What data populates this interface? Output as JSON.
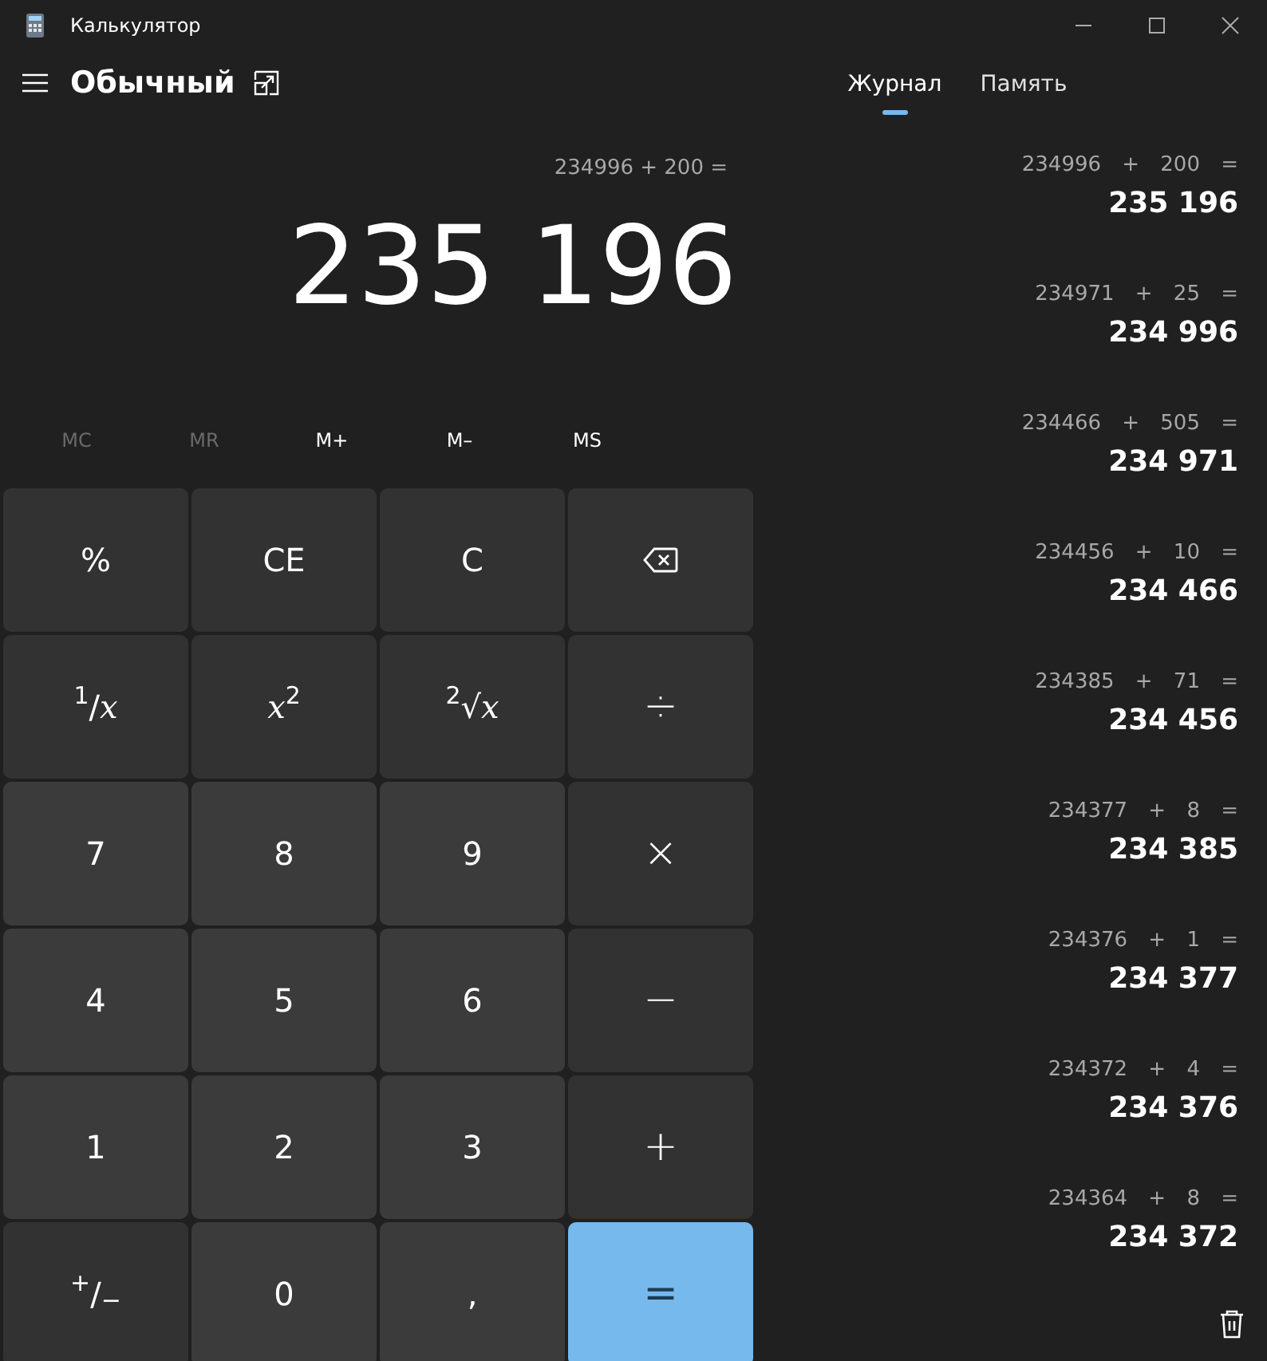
{
  "window": {
    "title": "Калькулятор"
  },
  "header": {
    "mode": "Обычный"
  },
  "tabs": [
    {
      "label": "Журнал",
      "selected": true
    },
    {
      "label": "Память",
      "selected": false
    }
  ],
  "display": {
    "expression": "234996 + 200 =",
    "value": "235 196"
  },
  "memory_buttons": [
    {
      "label": "MC",
      "disabled": true
    },
    {
      "label": "MR",
      "disabled": true
    },
    {
      "label": "M+",
      "disabled": false
    },
    {
      "label": "M–",
      "disabled": false
    },
    {
      "label": "MS",
      "disabled": false
    }
  ],
  "keys": [
    {
      "label": "%",
      "kind": "function"
    },
    {
      "label": "CE",
      "kind": "function"
    },
    {
      "label": "C",
      "kind": "function"
    },
    {
      "kind": "backspace"
    },
    {
      "label": "$^{1}$/*x*",
      "kind": "function"
    },
    {
      "label": "*x*$^{2}$",
      "kind": "function"
    },
    {
      "label": "$^{2}$√*x*",
      "kind": "function"
    },
    {
      "label": "÷",
      "kind": "operator"
    },
    {
      "label": "7",
      "kind": "digit"
    },
    {
      "label": "8",
      "kind": "digit"
    },
    {
      "label": "9",
      "kind": "digit"
    },
    {
      "label": "×",
      "kind": "operator"
    },
    {
      "label": "4",
      "kind": "digit"
    },
    {
      "label": "5",
      "kind": "digit"
    },
    {
      "label": "6",
      "kind": "digit"
    },
    {
      "label": "−",
      "kind": "operator"
    },
    {
      "label": "1",
      "kind": "digit"
    },
    {
      "label": "2",
      "kind": "digit"
    },
    {
      "label": "3",
      "kind": "digit"
    },
    {
      "label": "+",
      "kind": "operator"
    },
    {
      "label": "$^{+}$/$_{−}$",
      "kind": "function"
    },
    {
      "label": "0",
      "kind": "digit"
    },
    {
      "label": ",",
      "kind": "digit"
    },
    {
      "label": "=",
      "kind": "accent"
    }
  ],
  "history": [
    {
      "expression": "234996 + 200 =",
      "result": "235 196"
    },
    {
      "expression": "234971 + 25 =",
      "result": "234 996"
    },
    {
      "expression": "234466 + 505 =",
      "result": "234 971"
    },
    {
      "expression": "234456 + 10 =",
      "result": "234 466"
    },
    {
      "expression": "234385 + 71 =",
      "result": "234 456"
    },
    {
      "expression": "234377 + 8 =",
      "result": "234 385"
    },
    {
      "expression": "234376 + 1 =",
      "result": "234 377"
    },
    {
      "expression": "234372 + 4 =",
      "result": "234 376"
    },
    {
      "expression": "234364 + 8 =",
      "result": "234 372"
    }
  ]
}
